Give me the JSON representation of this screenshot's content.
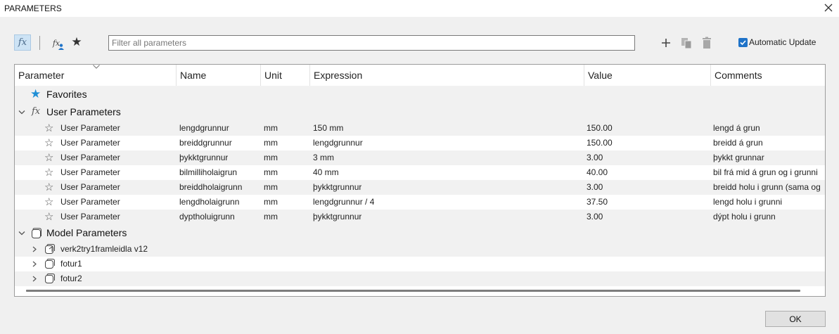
{
  "window": {
    "title": "PARAMETERS"
  },
  "toolbar": {
    "fx_label": "fx",
    "fx_user_label": "fx",
    "filter_placeholder": "Filter all parameters",
    "filter_value": "",
    "auto_update_label": "Automatic Update",
    "auto_update_checked": true,
    "accent_color": "#1f73c8"
  },
  "table": {
    "columns": [
      "Parameter",
      "Name",
      "Unit",
      "Expression",
      "Value",
      "Comments"
    ],
    "favorites_label": "Favorites",
    "user_params_label": "User Parameters",
    "user_params_icon": "fx",
    "user_rows": [
      {
        "param": "User Parameter",
        "name": "lengdgrunnur",
        "unit": "mm",
        "expression": "150 mm",
        "value": "150.00",
        "comment": "lengd á grun"
      },
      {
        "param": "User Parameter",
        "name": "breiddgrunnur",
        "unit": "mm",
        "expression": "lengdgrunnur",
        "value": "150.00",
        "comment": "breidd á grun"
      },
      {
        "param": "User Parameter",
        "name": "þykktgrunnur",
        "unit": "mm",
        "expression": "3 mm",
        "value": "3.00",
        "comment": "þykkt grunnar"
      },
      {
        "param": "User Parameter",
        "name": "bilmilliholaigrun",
        "unit": "mm",
        "expression": "40 mm",
        "value": "40.00",
        "comment": "bil frá mid á grun og i grunni"
      },
      {
        "param": "User Parameter",
        "name": "breiddholaigrunn",
        "unit": "mm",
        "expression": "þykktgrunnur",
        "value": "3.00",
        "comment": "breidd holu i grunn (sama og"
      },
      {
        "param": "User Parameter",
        "name": "lengdholaigrunn",
        "unit": "mm",
        "expression": "lengdgrunnur / 4",
        "value": "37.50",
        "comment": "lengd holu i grunni"
      },
      {
        "param": "User Parameter",
        "name": "dyptholuigrunn",
        "unit": "mm",
        "expression": "þykktgrunnur",
        "value": "3.00",
        "comment": "dýpt holu i grunn"
      }
    ],
    "model_params_label": "Model Parameters",
    "model_items": [
      "verk2try1framleidla v12",
      "fotur1",
      "fotur2"
    ]
  },
  "footer": {
    "ok_label": "OK"
  }
}
